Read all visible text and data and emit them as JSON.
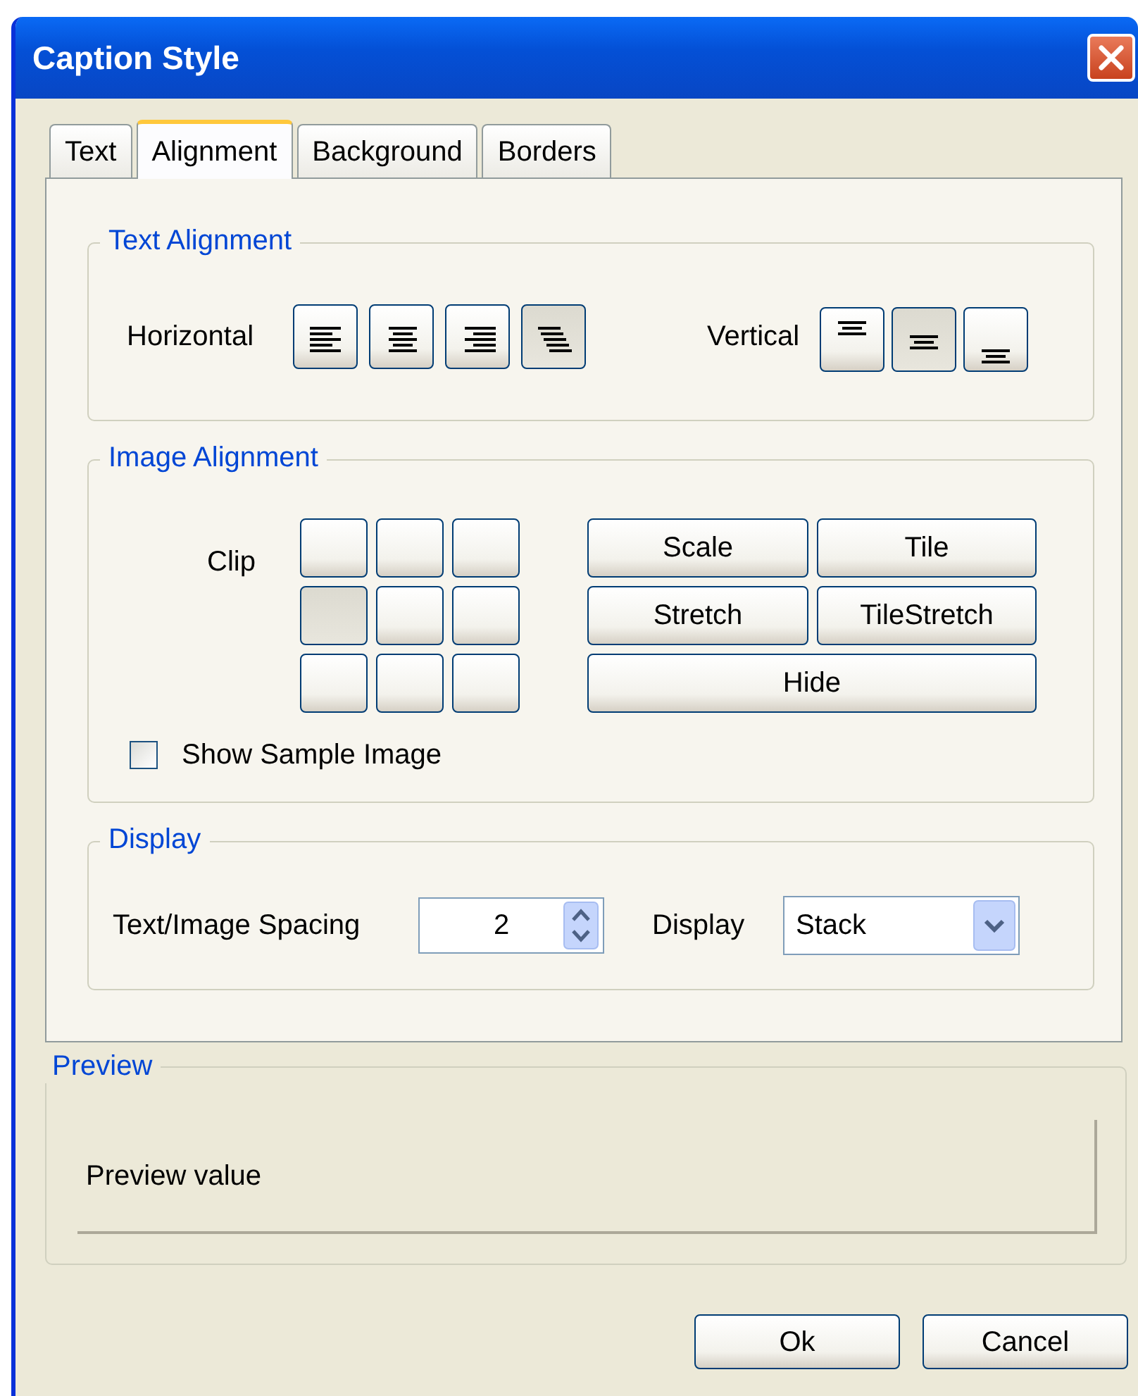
{
  "window": {
    "title": "Caption Style"
  },
  "tabs": [
    {
      "label": "Text",
      "selected": false
    },
    {
      "label": "Alignment",
      "selected": true
    },
    {
      "label": "Background",
      "selected": false
    },
    {
      "label": "Borders",
      "selected": false
    }
  ],
  "text_alignment": {
    "title": "Text Alignment",
    "horizontal_label": "Horizontal",
    "horizontal_options": [
      {
        "kind": "left",
        "selected": false
      },
      {
        "kind": "center",
        "selected": false
      },
      {
        "kind": "right",
        "selected": false
      },
      {
        "kind": "stagger",
        "selected": true
      }
    ],
    "vertical_label": "Vertical",
    "vertical_options": [
      {
        "kind": "top",
        "selected": false
      },
      {
        "kind": "middle",
        "selected": true
      },
      {
        "kind": "bottom",
        "selected": false
      }
    ]
  },
  "image_alignment": {
    "title": "Image Alignment",
    "clip_label": "Clip",
    "clip_cells": [
      {
        "selected": false
      },
      {
        "selected": false
      },
      {
        "selected": false
      },
      {
        "selected": true
      },
      {
        "selected": false
      },
      {
        "selected": false
      },
      {
        "selected": false
      },
      {
        "selected": false
      },
      {
        "selected": false
      }
    ],
    "modes": [
      {
        "label": "Scale"
      },
      {
        "label": "Tile"
      },
      {
        "label": "Stretch"
      },
      {
        "label": "TileStretch"
      },
      {
        "label": "Hide"
      }
    ],
    "show_sample": {
      "label": "Show Sample Image",
      "checked": false
    }
  },
  "display": {
    "title": "Display",
    "spacing_label": "Text/Image Spacing",
    "spacing_value": "2",
    "display_label": "Display",
    "display_value": "Stack"
  },
  "preview": {
    "title": "Preview",
    "text": "Preview value"
  },
  "buttons": [
    "Ok",
    "Cancel"
  ]
}
